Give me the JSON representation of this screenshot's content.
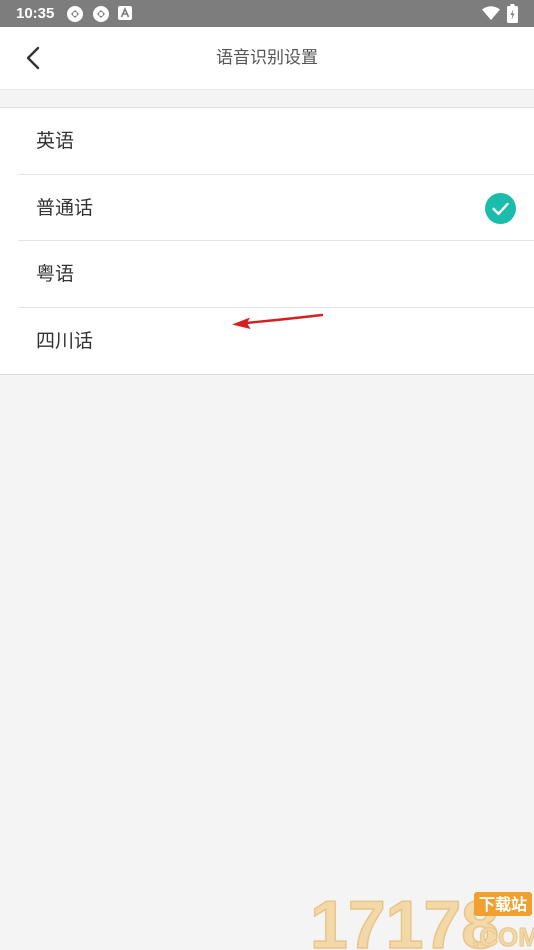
{
  "status_bar": {
    "time": "10:35",
    "icons": [
      "sync-icon",
      "sync-icon",
      "notification-a-icon",
      "wifi-icon",
      "battery-icon"
    ]
  },
  "header": {
    "back_icon": "chevron-left-icon",
    "title": "语音识别设置"
  },
  "languages": [
    {
      "label": "英语",
      "selected": false
    },
    {
      "label": "普通话",
      "selected": true
    },
    {
      "label": "粤语",
      "selected": false
    },
    {
      "label": "四川话",
      "selected": false
    }
  ],
  "colors": {
    "status_bar": "#7d7d7d",
    "accent_check": "#1cbcac",
    "annotation_arrow": "#d42020",
    "background": "#f4f4f4"
  },
  "watermark": {
    "number_text": "17178",
    "top_text": "下载站",
    "bottom_text": ".COM"
  }
}
